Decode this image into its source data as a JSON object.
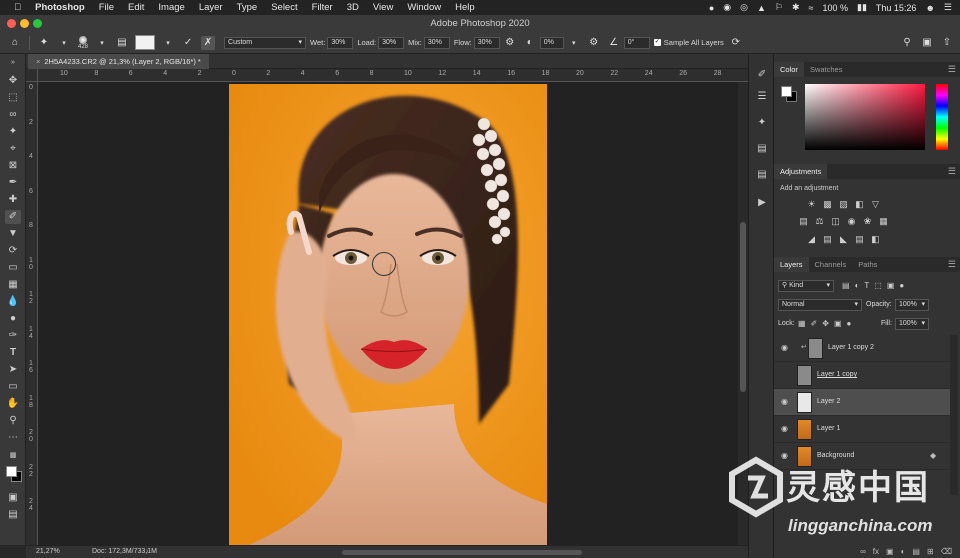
{
  "menubar": {
    "app": "Photoshop",
    "items": [
      "File",
      "Edit",
      "Image",
      "Layer",
      "Type",
      "Select",
      "Filter",
      "3D",
      "View",
      "Window",
      "Help"
    ],
    "battery": "100 %",
    "clock": "Thu 15:26"
  },
  "window": {
    "title": "Adobe Photoshop 2020"
  },
  "options": {
    "brush_size": "428",
    "sample_mode": "Custom",
    "wet_label": "Wet:",
    "wet": "30%",
    "load_label": "Load:",
    "load": "30%",
    "mix_label": "Mix:",
    "mix": "30%",
    "flow_label": "Flow:",
    "flow": "30%",
    "smooth": "0%",
    "angle": "0°",
    "sample_all_layers": "Sample All Layers"
  },
  "document": {
    "tab": "2H5A4233.CR2 @ 21,3% (Layer 2, RGB/16*) *",
    "zoom": "21,27%",
    "doc_info": "Doc: 172,3M/733,1M"
  },
  "rulers": {
    "h_ticks": [
      "10",
      "8",
      "6",
      "4",
      "2",
      "0",
      "2",
      "4",
      "6",
      "8",
      "10",
      "12",
      "14",
      "16",
      "18",
      "20",
      "22",
      "24",
      "26",
      "28"
    ],
    "v_ticks": [
      "0",
      "2",
      "4",
      "6",
      "8",
      "1\n0",
      "1\n2",
      "1\n4",
      "1\n6",
      "1\n8",
      "2\n0",
      "2\n2",
      "2\n4"
    ]
  },
  "color_panel": {
    "tabs": [
      "Color",
      "Swatches"
    ],
    "active": "Color"
  },
  "adjustments_panel": {
    "title": "Adjustments",
    "hint": "Add an adjustment"
  },
  "layers_panel": {
    "tabs": [
      "Layers",
      "Channels",
      "Paths"
    ],
    "active": "Layers",
    "filter_kind": "Kind",
    "blend_mode": "Normal",
    "opacity_label": "Opacity:",
    "opacity": "100%",
    "lock_label": "Lock:",
    "fill_label": "Fill:",
    "fill": "100%",
    "layers": [
      {
        "name": "Layer 1 copy 2",
        "visible": true,
        "selected": false,
        "thumb": "#8a8a8a"
      },
      {
        "name": "Layer 1 copy",
        "visible": false,
        "selected": false,
        "thumb": "#8a8a8a"
      },
      {
        "name": "Layer 2",
        "visible": true,
        "selected": true,
        "thumb": "#e8e8e8"
      },
      {
        "name": "Layer 1",
        "visible": true,
        "selected": false,
        "thumb": "#e08a2a"
      },
      {
        "name": "Background",
        "visible": true,
        "selected": false,
        "thumb": "#e08a2a"
      }
    ]
  },
  "watermark": {
    "brand_cn": "灵感中国",
    "url": "lingganchina.com"
  },
  "colors": {
    "accent_orange": "#f19518",
    "panel_bg": "#333333",
    "selected_row": "#4e4e4e"
  }
}
